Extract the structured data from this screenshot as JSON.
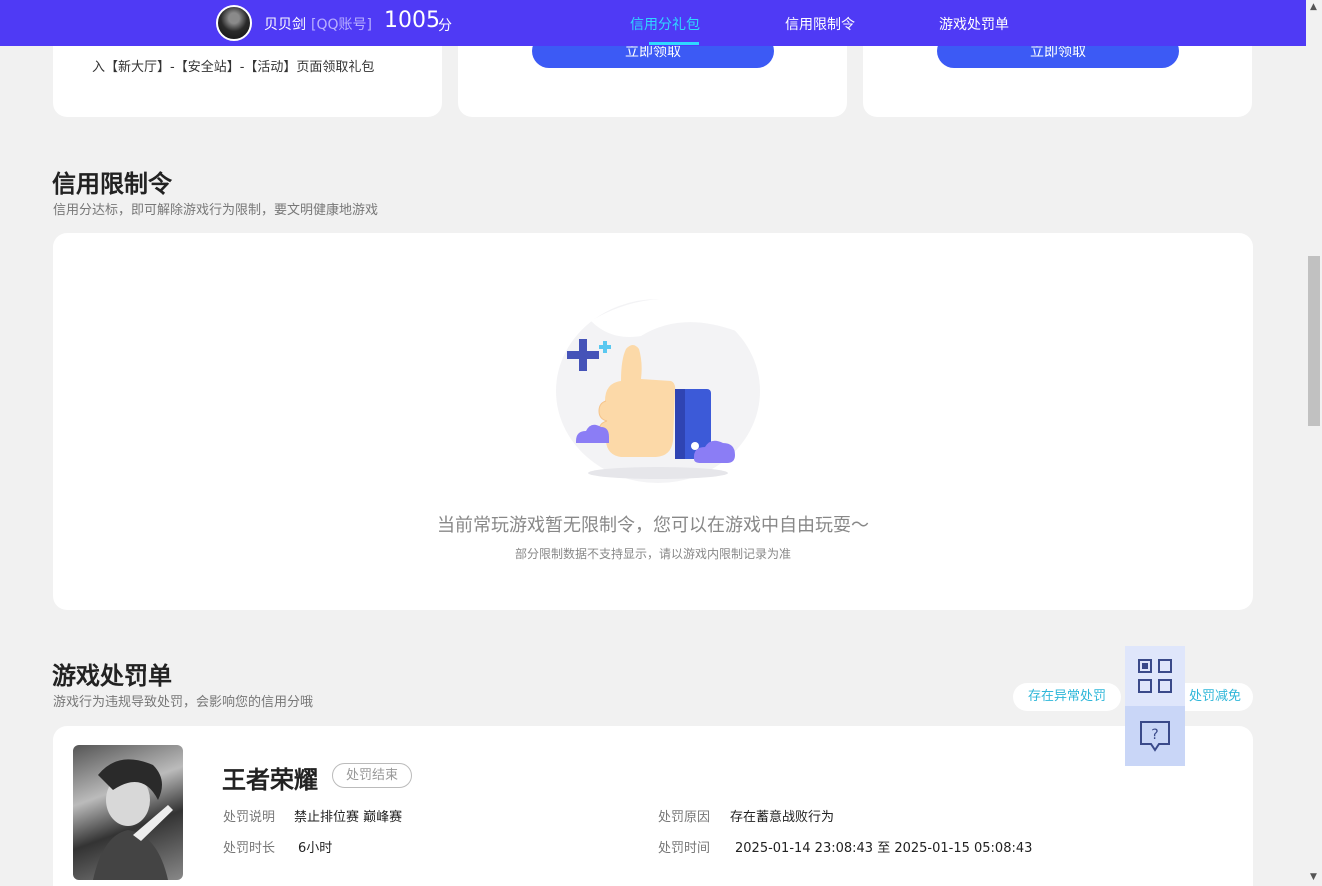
{
  "header": {
    "username": "贝贝剑",
    "account_type": "[QQ账号]",
    "score": "1005",
    "score_unit": "分",
    "nav": [
      {
        "label": "信用分礼包"
      },
      {
        "label": "信用限制令"
      },
      {
        "label": "游戏处罚单"
      }
    ]
  },
  "gifts": {
    "card1_text": "入【新大厅】-【安全站】-【活动】页面领取礼包",
    "claim_label": "立即领取"
  },
  "restriction": {
    "title": "信用限制令",
    "subtitle": "信用分达标，即可解除游戏行为限制，要文明健康地游戏",
    "empty_message": "当前常玩游戏暂无限制令，您可以在游戏中自由玩耍～",
    "empty_note": "部分限制数据不支持显示，请以游戏内限制记录为准"
  },
  "penalties": {
    "title": "游戏处罚单",
    "subtitle": "游戏行为违规导致处罚，会影响您的信用分哦",
    "pill_abnormal": "存在异常处罚",
    "pill_reduce": "处罚减免",
    "items": [
      {
        "game": "王者荣耀",
        "status": "处罚结束",
        "desc_label": "处罚说明",
        "desc_value": "禁止排位赛 巅峰赛",
        "reason_label": "处罚原因",
        "reason_value": "存在蓄意战败行为",
        "duration_label": "处罚时长",
        "duration_value": "6小时",
        "time_label": "处罚时间",
        "time_value": "2025-01-14 23:08:43 至 2025-01-15 05:08:43"
      }
    ]
  },
  "floating": {
    "qr_icon": "qr-code-icon",
    "help_icon": "help-chat-icon"
  },
  "colors": {
    "brand": "#4f3af5",
    "nav_active": "#2fd9ff",
    "button": "#3c5af5",
    "link": "#2fb7d9"
  }
}
